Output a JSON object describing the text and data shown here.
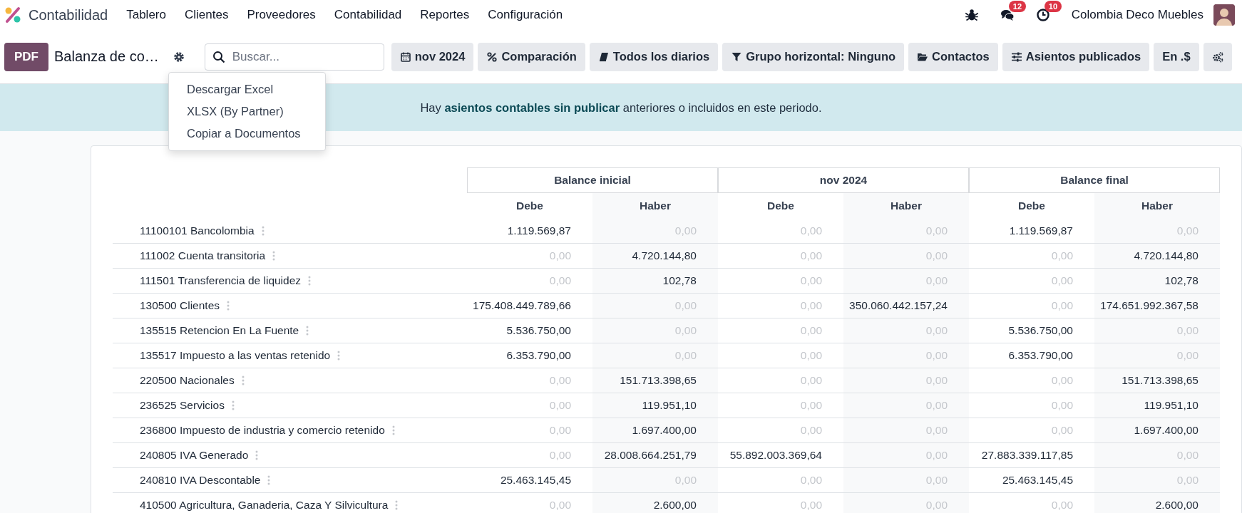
{
  "navbar": {
    "app_name": "Contabilidad",
    "menu": [
      "Tablero",
      "Clientes",
      "Proveedores",
      "Contabilidad",
      "Reportes",
      "Configuración"
    ],
    "messages_badge": "12",
    "activities_badge": "10",
    "company": "Colombia Deco Muebles"
  },
  "control_bar": {
    "pdf_button": "PDF",
    "report_title": "Balanza de co…",
    "search": {
      "placeholder": "Buscar..."
    },
    "filters": [
      {
        "kind": "calendar",
        "label": "nov 2024"
      },
      {
        "kind": "percent",
        "label": "Comparación"
      },
      {
        "kind": "book",
        "label": "Todos los diarios"
      },
      {
        "kind": "filter",
        "label": "Grupo horizontal: Ninguno"
      },
      {
        "kind": "folder",
        "label": "Contactos"
      },
      {
        "kind": "sliders",
        "label": "Asientos publicados"
      },
      {
        "kind": "text",
        "label": "En .$"
      },
      {
        "kind": "gears"
      }
    ]
  },
  "settings_menu": {
    "items": [
      "Descargar Excel",
      "XLSX (By Partner)",
      "Copiar a Documentos"
    ]
  },
  "banner": "Hay **asientos contables sin publicar** anteriores o incluidos en este periodo.",
  "table": {
    "column_groups": [
      "Balance inicial",
      "nov 2024",
      "Balance final"
    ],
    "columns": [
      "Debe",
      "Haber",
      "Debe",
      "Haber",
      "Debe",
      "Haber"
    ],
    "rows": [
      {
        "account": "11100101 Bancolombia",
        "cells": [
          {
            "text": "1.119.569,87",
            "muted": false
          },
          {
            "text": "0,00",
            "muted": true
          },
          {
            "text": "0,00",
            "muted": true
          },
          {
            "text": "0,00",
            "muted": true
          },
          {
            "text": "1.119.569,87",
            "muted": false
          },
          {
            "text": "0,00",
            "muted": true
          }
        ]
      },
      {
        "account": "111002 Cuenta transitoria",
        "cells": [
          {
            "text": "0,00",
            "muted": true
          },
          {
            "text": "4.720.144,80",
            "muted": false
          },
          {
            "text": "0,00",
            "muted": true
          },
          {
            "text": "0,00",
            "muted": true
          },
          {
            "text": "0,00",
            "muted": true
          },
          {
            "text": "4.720.144,80",
            "muted": false
          }
        ]
      },
      {
        "account": "111501 Transferencia de liquidez",
        "cells": [
          {
            "text": "0,00",
            "muted": true
          },
          {
            "text": "102,78",
            "muted": false
          },
          {
            "text": "0,00",
            "muted": true
          },
          {
            "text": "0,00",
            "muted": true
          },
          {
            "text": "0,00",
            "muted": true
          },
          {
            "text": "102,78",
            "muted": false
          }
        ]
      },
      {
        "account": "130500 Clientes",
        "cells": [
          {
            "text": "175.408.449.789,66",
            "muted": false
          },
          {
            "text": "0,00",
            "muted": true
          },
          {
            "text": "0,00",
            "muted": true
          },
          {
            "text": "350.060.442.157,24",
            "muted": false
          },
          {
            "text": "0,00",
            "muted": true
          },
          {
            "text": "174.651.992.367,58",
            "muted": false
          }
        ]
      },
      {
        "account": "135515 Retencion En La Fuente",
        "cells": [
          {
            "text": "5.536.750,00",
            "muted": false
          },
          {
            "text": "0,00",
            "muted": true
          },
          {
            "text": "0,00",
            "muted": true
          },
          {
            "text": "0,00",
            "muted": true
          },
          {
            "text": "5.536.750,00",
            "muted": false
          },
          {
            "text": "0,00",
            "muted": true
          }
        ]
      },
      {
        "account": "135517 Impuesto a las ventas retenido",
        "cells": [
          {
            "text": "6.353.790,00",
            "muted": false
          },
          {
            "text": "0,00",
            "muted": true
          },
          {
            "text": "0,00",
            "muted": true
          },
          {
            "text": "0,00",
            "muted": true
          },
          {
            "text": "6.353.790,00",
            "muted": false
          },
          {
            "text": "0,00",
            "muted": true
          }
        ]
      },
      {
        "account": "220500 Nacionales",
        "cells": [
          {
            "text": "0,00",
            "muted": true
          },
          {
            "text": "151.713.398,65",
            "muted": false
          },
          {
            "text": "0,00",
            "muted": true
          },
          {
            "text": "0,00",
            "muted": true
          },
          {
            "text": "0,00",
            "muted": true
          },
          {
            "text": "151.713.398,65",
            "muted": false
          }
        ]
      },
      {
        "account": "236525 Servicios",
        "cells": [
          {
            "text": "0,00",
            "muted": true
          },
          {
            "text": "119.951,10",
            "muted": false
          },
          {
            "text": "0,00",
            "muted": true
          },
          {
            "text": "0,00",
            "muted": true
          },
          {
            "text": "0,00",
            "muted": true
          },
          {
            "text": "119.951,10",
            "muted": false
          }
        ]
      },
      {
        "account": "236800 Impuesto de industria y comercio retenido",
        "cells": [
          {
            "text": "0,00",
            "muted": true
          },
          {
            "text": "1.697.400,00",
            "muted": false
          },
          {
            "text": "0,00",
            "muted": true
          },
          {
            "text": "0,00",
            "muted": true
          },
          {
            "text": "0,00",
            "muted": true
          },
          {
            "text": "1.697.400,00",
            "muted": false
          }
        ]
      },
      {
        "account": "240805 IVA Generado",
        "cells": [
          {
            "text": "0,00",
            "muted": true
          },
          {
            "text": "28.008.664.251,79",
            "muted": false
          },
          {
            "text": "55.892.003.369,64",
            "muted": false
          },
          {
            "text": "0,00",
            "muted": true
          },
          {
            "text": "27.883.339.117,85",
            "muted": false
          },
          {
            "text": "0,00",
            "muted": true
          }
        ]
      },
      {
        "account": "240810 IVA Descontable",
        "cells": [
          {
            "text": "25.463.145,45",
            "muted": false
          },
          {
            "text": "0,00",
            "muted": true
          },
          {
            "text": "0,00",
            "muted": true
          },
          {
            "text": "0,00",
            "muted": true
          },
          {
            "text": "25.463.145,45",
            "muted": false
          },
          {
            "text": "0,00",
            "muted": true
          }
        ]
      },
      {
        "account": "410500 Agricultura, Ganaderia, Caza Y Silvicultura",
        "cells": [
          {
            "text": "0,00",
            "muted": true
          },
          {
            "text": "2.600,00",
            "muted": false
          },
          {
            "text": "0,00",
            "muted": true
          },
          {
            "text": "0,00",
            "muted": true
          },
          {
            "text": "0,00",
            "muted": true
          },
          {
            "text": "2.600,00",
            "muted": false
          }
        ]
      }
    ]
  }
}
